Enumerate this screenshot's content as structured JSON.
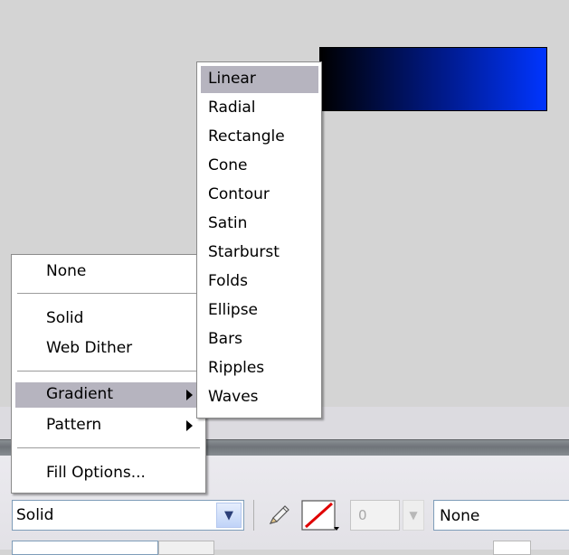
{
  "canvas": {
    "gradient_colors": [
      "#000000",
      "#001a8c",
      "#0035ff"
    ]
  },
  "fill_menu": {
    "items": [
      {
        "label": "None",
        "submenu": false,
        "highlighted": false
      },
      {
        "label": "Solid",
        "submenu": false,
        "highlighted": false
      },
      {
        "label": "Web Dither",
        "submenu": false,
        "highlighted": false
      },
      {
        "label": "Gradient",
        "submenu": true,
        "highlighted": true
      },
      {
        "label": "Pattern",
        "submenu": true,
        "highlighted": false
      },
      {
        "label": "Fill Options...",
        "submenu": false,
        "highlighted": false
      }
    ]
  },
  "gradient_menu": {
    "items": [
      {
        "label": "Linear",
        "highlighted": true
      },
      {
        "label": "Radial"
      },
      {
        "label": "Rectangle"
      },
      {
        "label": "Cone"
      },
      {
        "label": "Contour"
      },
      {
        "label": "Satin"
      },
      {
        "label": "Starburst"
      },
      {
        "label": "Folds"
      },
      {
        "label": "Ellipse"
      },
      {
        "label": "Bars"
      },
      {
        "label": "Ripples"
      },
      {
        "label": "Waves"
      }
    ]
  },
  "properties": {
    "fill_type": "Solid",
    "stroke_width": "0",
    "stroke_cap": "None",
    "stroke_icon": "no-stroke-slash-icon",
    "pencil_icon": "pencil-icon",
    "accent_highlight": "#b6b4bf"
  }
}
